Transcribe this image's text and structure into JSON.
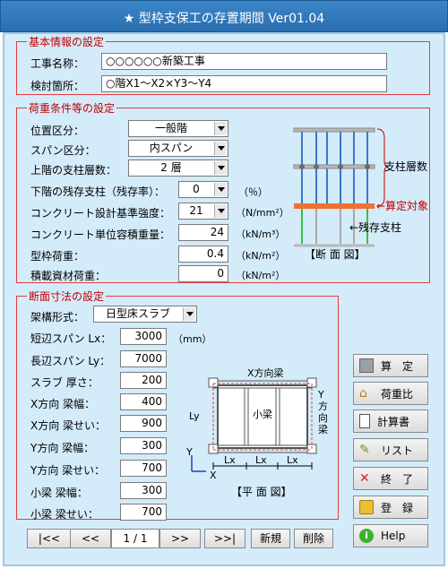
{
  "window": {
    "title": "★ 型枠支保工の存置期間 Ver01.04"
  },
  "basic": {
    "legend": "基本情報の設定",
    "project_label": "工事名称：",
    "project_value": "○○○○○○新築工事",
    "location_label": "検討箇所：",
    "location_value": "○階X1～X2×Y3～Y4"
  },
  "load": {
    "legend": "荷重条件等の設定",
    "position_label": "位置区分：",
    "position_value": "一般階",
    "span_label": "スパン区分：",
    "span_value": "内スパン",
    "upper_label": "上階の支柱層数：",
    "upper_value": "2 層",
    "lower_label": "下階の残存支柱（残存率）：",
    "lower_value": "0",
    "lower_unit": "（％）",
    "design_label": "コンクリート設計基準強度：",
    "design_value": "21",
    "design_unit": "（N/mm²）",
    "weight_label": "コンクリート単位容積重量：",
    "weight_value": "24",
    "weight_unit": "（kN/m³）",
    "form_label": "型枠荷重：",
    "form_value": "0.4",
    "form_unit": "（kN/m²）",
    "material_label": "積載資材荷重：",
    "material_value": "0",
    "material_unit": "（kN/m²）",
    "diagram": {
      "support_layers": "支柱層数",
      "calc_target": "←算定対象",
      "remaining": "←残存支柱",
      "caption": "【断 面 図】"
    }
  },
  "section": {
    "legend": "断面寸法の設定",
    "frame_label": "架構形式：",
    "frame_value": "日型床スラブ",
    "lx_label": "短辺スパン Lx：",
    "lx_value": "3000",
    "lx_unit": "（mm）",
    "ly_label": "長辺スパン Ly：",
    "ly_value": "7000",
    "slab_label": "スラブ 厚さ：",
    "slab_value": "200",
    "xbw_label": "X方向 梁幅：",
    "xbw_value": "400",
    "xbd_label": "X方向 梁せい：",
    "xbd_value": "900",
    "ybw_label": "Y方向 梁幅：",
    "ybw_value": "300",
    "ybd_label": "Y方向 梁せい：",
    "ybd_value": "700",
    "sbw_label": "小梁 梁幅：",
    "sbw_value": "300",
    "sbd_label": "小梁 梁せい：",
    "sbd_value": "700",
    "plan": {
      "xbeam": "X方向梁",
      "ybeam": "Y方向梁",
      "small": "小梁",
      "ly": "Ly",
      "lx1": "Lx",
      "lx2": "Lx",
      "lx3": "Lx",
      "y": "Y",
      "x": "X",
      "caption": "【平 面 図】"
    }
  },
  "buttons": {
    "calc": "算　定",
    "load_ratio": "荷重比",
    "report": "計算書",
    "list": "リスト",
    "exit": "終　了",
    "register": "登　録",
    "help": "Help"
  },
  "nav": {
    "first": "|<<",
    "prev": "<<",
    "page": "1 / 1",
    "next": ">>",
    "last": ">>|",
    "new": "新規",
    "delete": "削除"
  },
  "colors": {
    "title_bar": "#2a6eb0",
    "frame_bg": "#d4ebfa",
    "legend_red": "#c00000",
    "support_blue": "#3a78c9",
    "target_orange": "#f07030",
    "remain_green": "#3ac03a"
  }
}
